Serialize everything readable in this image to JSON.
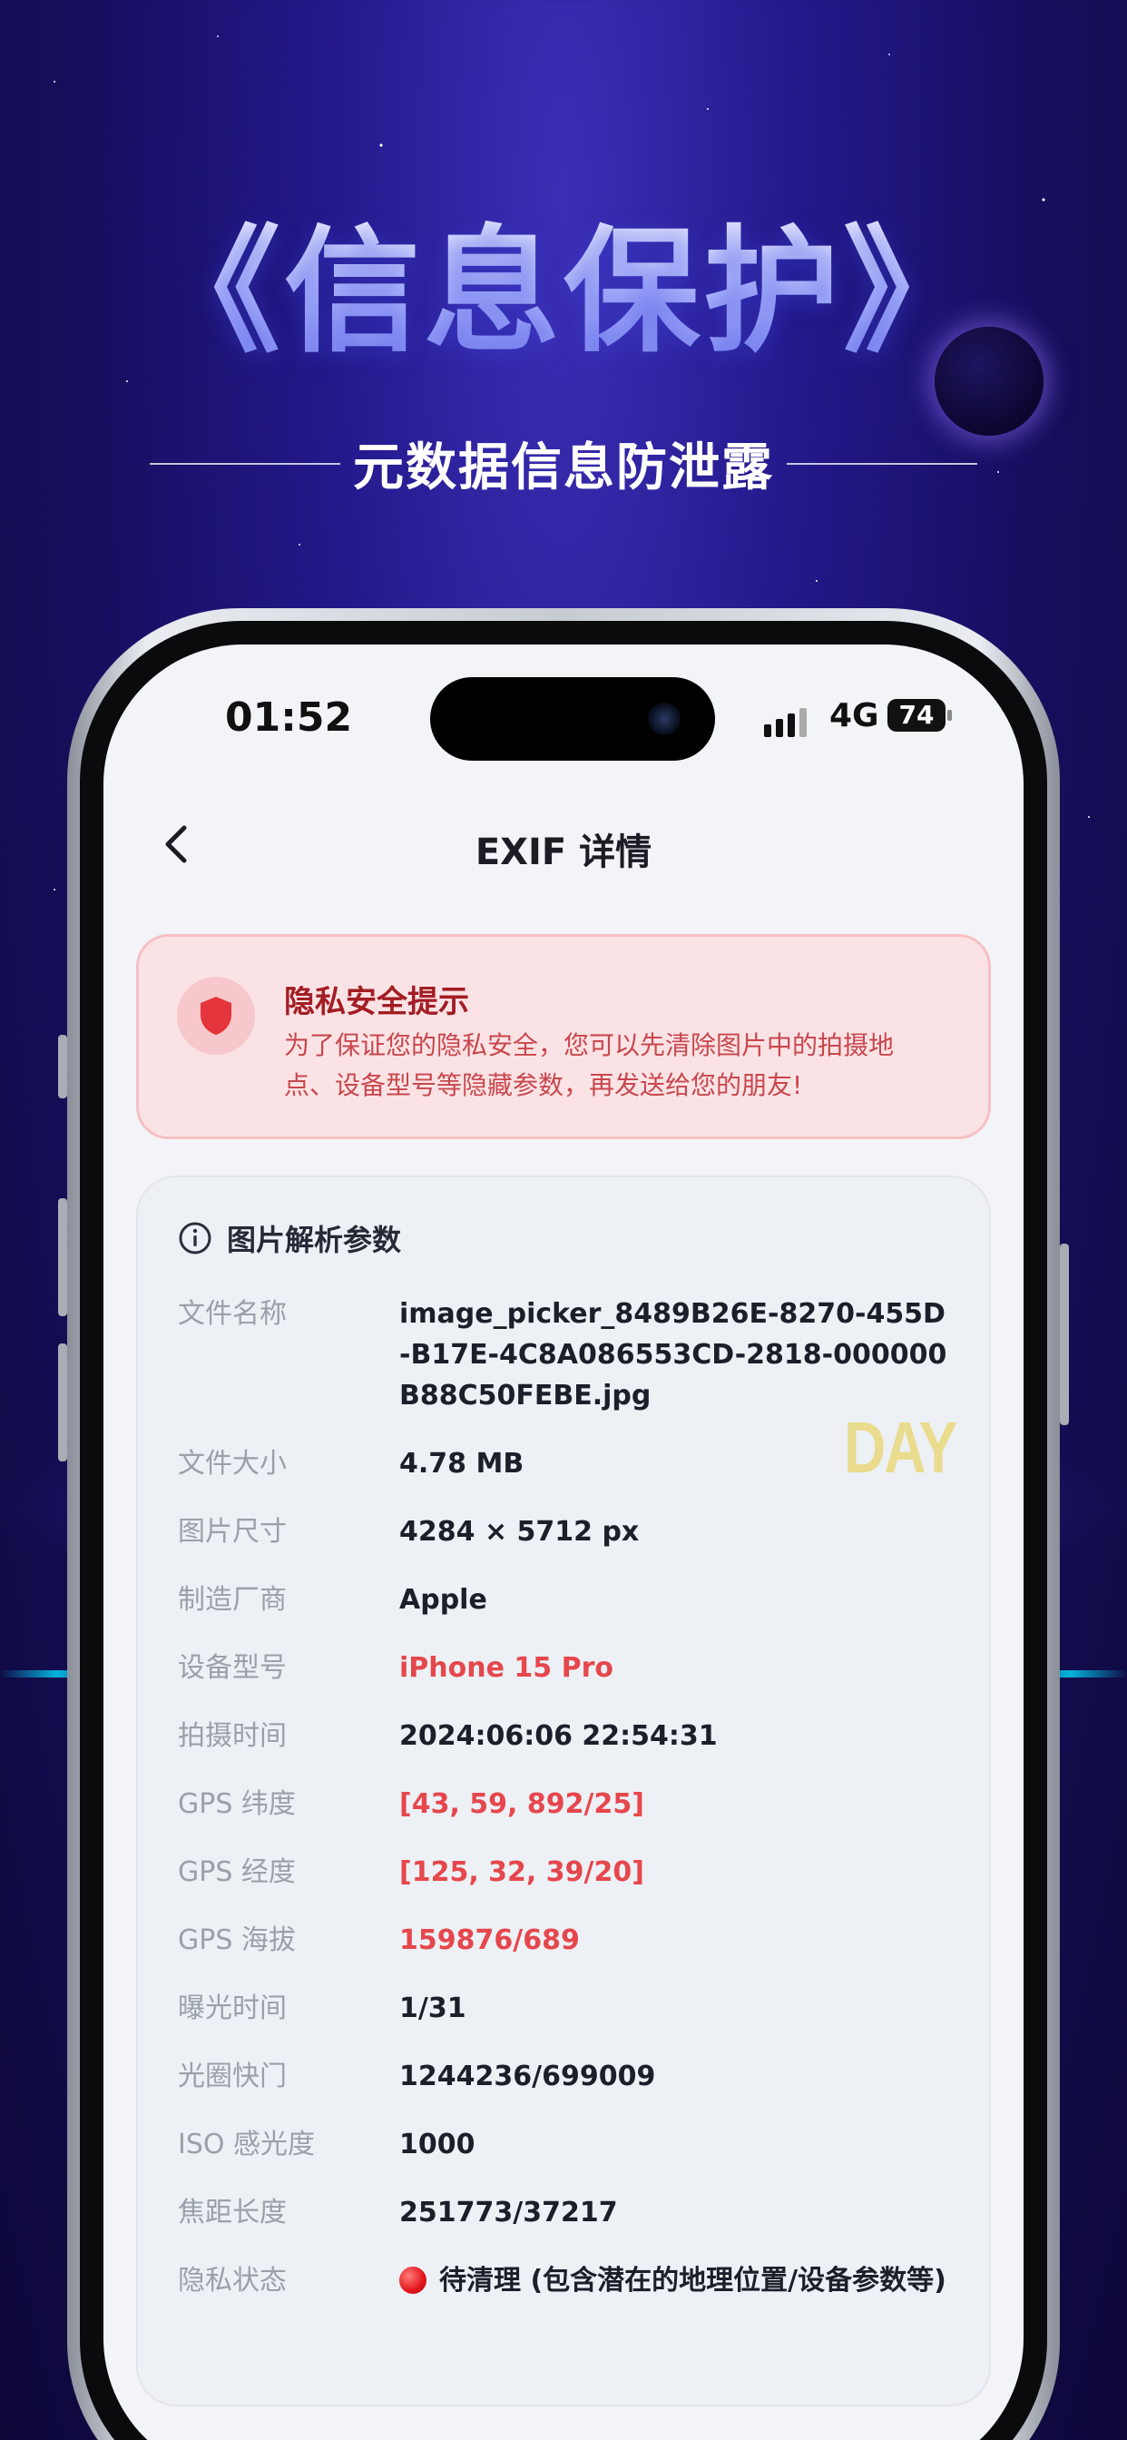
{
  "poster": {
    "headline": "《信息保护》",
    "subtitle": "元数据信息防泄露"
  },
  "status_bar": {
    "time": "01:52",
    "network": "4G",
    "battery": "74"
  },
  "nav": {
    "title": "EXIF 详情"
  },
  "privacy_alert": {
    "title": "隐私安全提示",
    "text": "为了保证您的隐私安全，您可以先清除图片中的拍摄地点、设备型号等隐藏参数，再发送给您的朋友!"
  },
  "card": {
    "title": "图片解析参数",
    "rows": [
      {
        "label": "文件名称",
        "value": "image_picker_8489B26E-8270-455D-B17E-4C8A086553CD-2818-000000B88C50FEBE.jpg"
      },
      {
        "label": "文件大小",
        "value": "4.78 MB"
      },
      {
        "label": "图片尺寸",
        "value": "4284 × 5712 px"
      },
      {
        "label": "制造厂商",
        "value": "Apple"
      },
      {
        "label": "设备型号",
        "value": "iPhone 15 Pro"
      },
      {
        "label": "拍摄时间",
        "value": "2024:06:06 22:54:31"
      },
      {
        "label": "GPS 纬度",
        "value": "[43, 59, 892/25]"
      },
      {
        "label": "GPS 经度",
        "value": "[125, 32, 39/20]"
      },
      {
        "label": "GPS 海拔",
        "value": "159876/689"
      },
      {
        "label": "曝光时间",
        "value": "1/31"
      },
      {
        "label": "光圈快门",
        "value": "1244236/699009"
      },
      {
        "label": "ISO 感光度",
        "value": "1000"
      },
      {
        "label": "焦距长度",
        "value": "251773/37217"
      },
      {
        "label": "隐私状态",
        "value": "待清理 (包含潜在的地理位置/设备参数等)"
      }
    ]
  },
  "watermark": "DAY",
  "colors": {
    "accent_red": "#e5474c",
    "alert_bg": "#fbe3e5",
    "background_space": "#23188a"
  }
}
